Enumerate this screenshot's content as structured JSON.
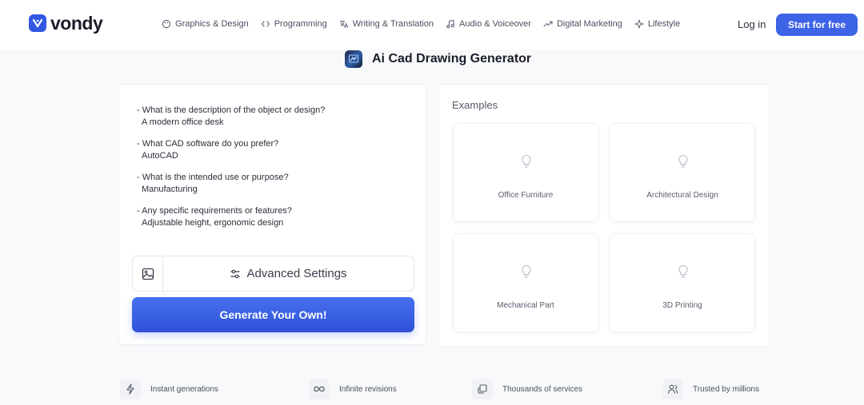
{
  "brand": {
    "name": "vondy",
    "color": "#3157e3"
  },
  "nav": {
    "items": [
      {
        "label": "Graphics & Design",
        "icon": "palette-icon"
      },
      {
        "label": "Programming",
        "icon": "code-icon"
      },
      {
        "label": "Writing & Translation",
        "icon": "translate-icon"
      },
      {
        "label": "Audio & Voiceover",
        "icon": "music-note-icon"
      },
      {
        "label": "Digital Marketing",
        "icon": "trending-up-icon"
      },
      {
        "label": "Lifestyle",
        "icon": "sparkle-icon"
      }
    ],
    "login_label": "Log in",
    "cta_label": "Start for free"
  },
  "page": {
    "title": "Ai Cad Drawing Generator"
  },
  "prompt": {
    "items": [
      {
        "q": "- What is the description of the object or design?",
        "a": "A modern office desk"
      },
      {
        "q": "- What CAD software do you prefer?",
        "a": "AutoCAD"
      },
      {
        "q": "- What is the intended use or purpose?",
        "a": "Manufacturing"
      },
      {
        "q": "- Any specific requirements or features?",
        "a": "Adjustable height, ergonomic design"
      }
    ]
  },
  "controls": {
    "advanced_label": "Advanced Settings",
    "generate_label": "Generate Your Own!"
  },
  "examples": {
    "label": "Examples",
    "items": [
      "Office Furniture",
      "Architectural Design",
      "Mechanical Part",
      "3D Printing"
    ]
  },
  "features": {
    "items": [
      {
        "label": "Instant generations",
        "icon": "lightning-icon"
      },
      {
        "label": "Infinite revisions",
        "icon": "infinity-icon"
      },
      {
        "label": "Thousands of services",
        "icon": "layers-icon"
      },
      {
        "label": "Trusted by millions",
        "icon": "users-icon"
      }
    ]
  },
  "colors": {
    "accent": "#3d63e6",
    "button_gradient_top": "#4670ef",
    "button_gradient_bottom": "#2f52d8"
  }
}
